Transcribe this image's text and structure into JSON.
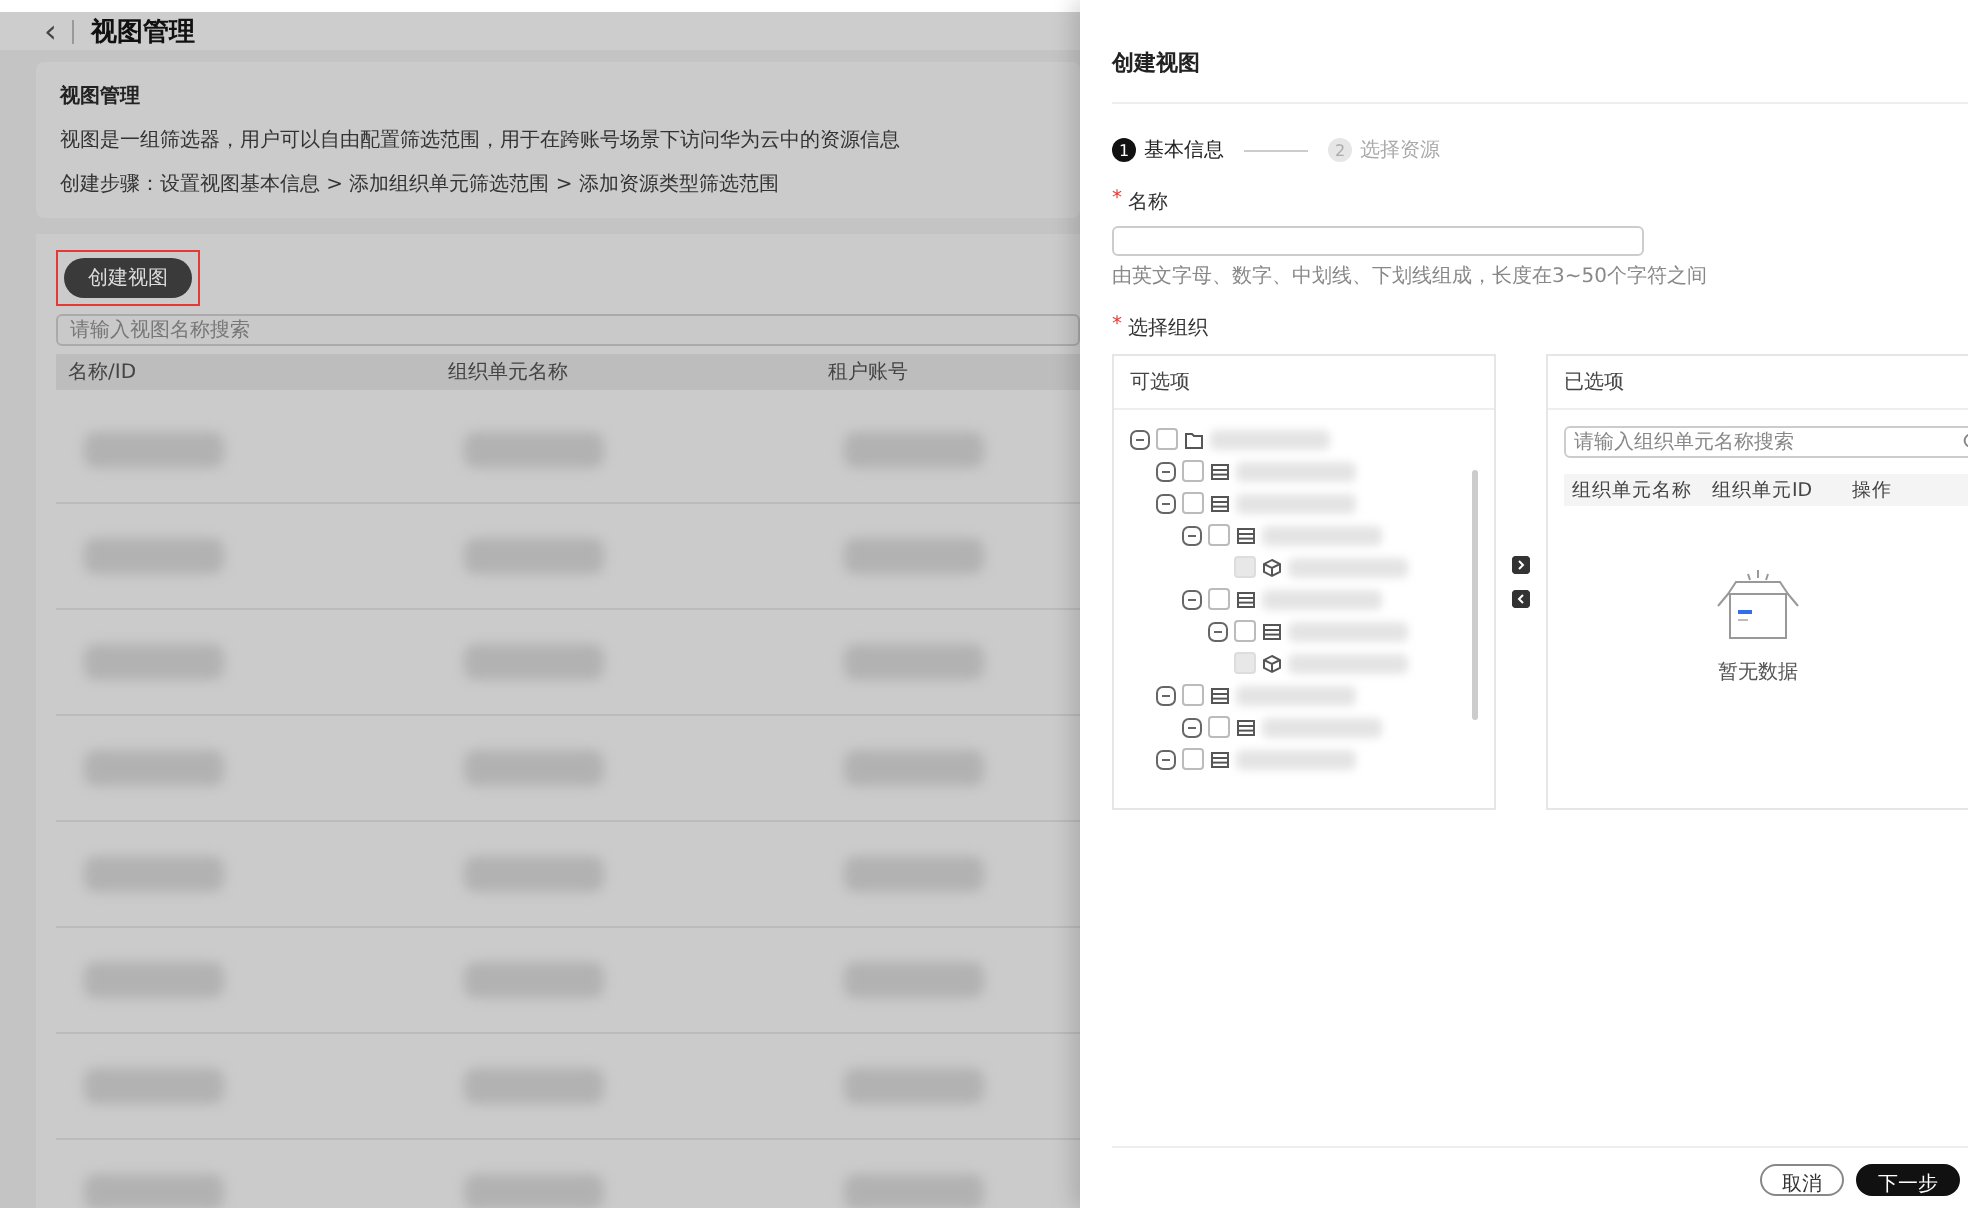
{
  "page": {
    "back_icon": "‹",
    "title": "视图管理"
  },
  "intro": {
    "heading": "视图管理",
    "lines": [
      "视图是一组筛选器，用户可以自由配置筛选范围，用于在跨账号场景下访问华为云中的资源信息",
      "创建步骤：设置视图基本信息 > 添加组织单元筛选范围 > 添加资源类型筛选范围"
    ]
  },
  "create_button": "创建视图",
  "search": {
    "placeholder": "请输入视图名称搜索"
  },
  "table": {
    "columns": [
      "名称/ID",
      "组织单元名称",
      "租户账号"
    ]
  },
  "drawer": {
    "title": "创建视图",
    "steps": [
      {
        "number": "1",
        "label": "基本信息",
        "selected": true
      },
      {
        "number": "2",
        "label": "选择资源",
        "selected": false
      }
    ],
    "name_field": {
      "required_mark": "*",
      "label": "名称",
      "hint": "由英文字母、数字、中划线、下划线组成，长度在3~50个字符之间"
    },
    "org_label": {
      "required_mark": "*",
      "label": "选择组织"
    },
    "available": {
      "title": "可选项",
      "tree": [
        {
          "kind": "folder",
          "expanded": true,
          "checked": false,
          "disabled": false,
          "children": [
            {
              "kind": "unit",
              "expanded": true,
              "checked": false,
              "disabled": false
            },
            {
              "kind": "unit",
              "expanded": true,
              "checked": false,
              "disabled": false,
              "children": [
                {
                  "kind": "unit",
                  "expanded": true,
                  "checked": false,
                  "disabled": false,
                  "children": [
                    {
                      "kind": "resource",
                      "checked": false,
                      "disabled": true
                    }
                  ]
                },
                {
                  "kind": "unit",
                  "expanded": true,
                  "checked": false,
                  "disabled": false,
                  "children": [
                    {
                      "kind": "unit",
                      "expanded": true,
                      "checked": false,
                      "disabled": false
                    },
                    {
                      "kind": "resource",
                      "checked": false,
                      "disabled": true
                    }
                  ]
                }
              ]
            },
            {
              "kind": "unit",
              "expanded": true,
              "checked": false,
              "disabled": false,
              "children": [
                {
                  "kind": "unit",
                  "expanded": true,
                  "checked": false,
                  "disabled": false
                }
              ]
            },
            {
              "kind": "unit",
              "expanded": true,
              "checked": false,
              "disabled": false
            }
          ]
        }
      ]
    },
    "selected": {
      "title": "已选项",
      "search_placeholder": "请输入组织单元名称搜索",
      "columns": [
        "组织单元名称",
        "组织单元ID",
        "操作"
      ],
      "empty_text": "暂无数据"
    },
    "buttons": [
      {
        "label": "取消",
        "kind": "secondary"
      },
      {
        "label": "下一步",
        "kind": "primary"
      }
    ]
  }
}
